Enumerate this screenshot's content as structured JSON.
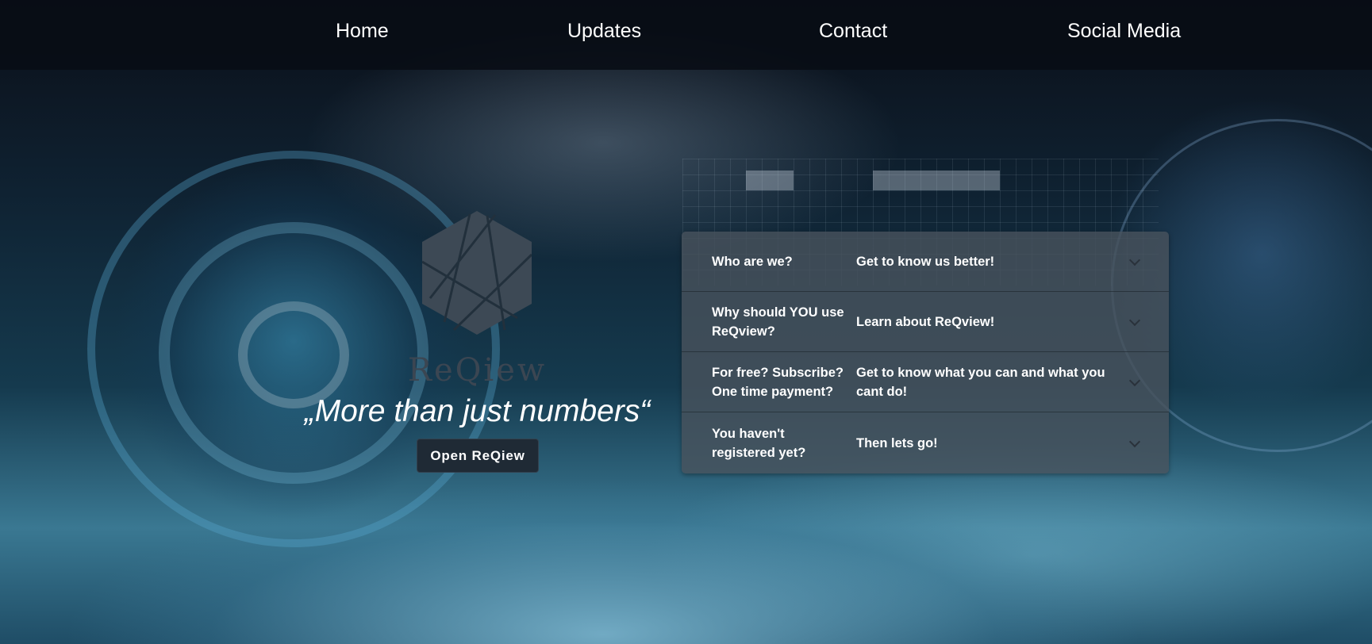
{
  "nav": {
    "items": [
      {
        "label": "Home"
      },
      {
        "label": "Updates"
      },
      {
        "label": "Contact"
      },
      {
        "label": "Social Media"
      }
    ]
  },
  "hero": {
    "logo_icon": "hexagon-logo-icon",
    "brand_name": "ReQiew",
    "tagline": "„More than just numbers“",
    "cta_label": "Open ReQiew"
  },
  "faq": {
    "items": [
      {
        "question": "Who are we?",
        "answer": "Get to know us better!"
      },
      {
        "question": "Why should YOU use ReQview?",
        "answer": "Learn about ReQview!"
      },
      {
        "question": "For free? Subscribe? One time payment?",
        "answer": "Get to know what you can and what you cant do!"
      },
      {
        "question": "You haven't registered yet?",
        "answer": "Then lets go!"
      }
    ],
    "toggle_icon": "chevron-down-icon"
  }
}
